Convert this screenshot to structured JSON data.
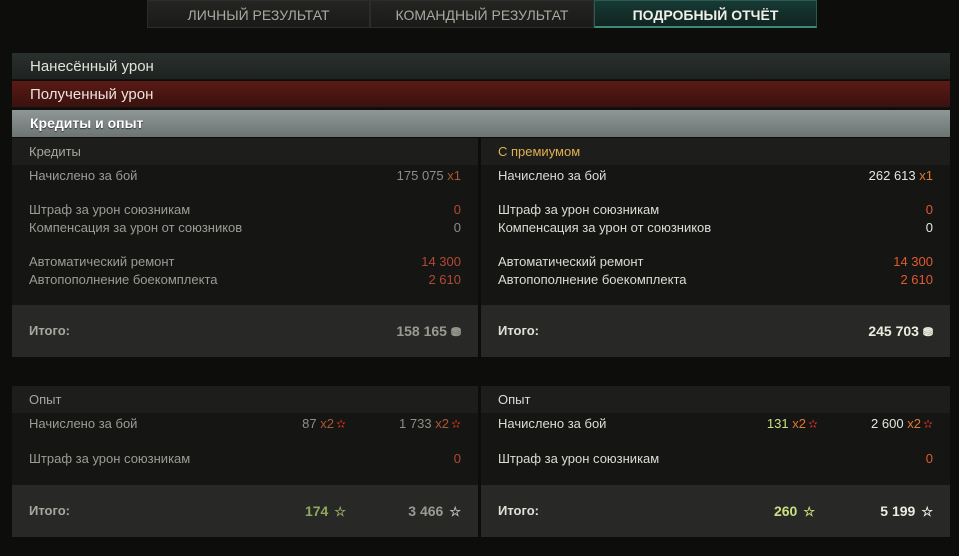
{
  "tabs": [
    "ЛИЧНЫЙ РЕЗУЛЬТАТ",
    "КОМАНДНЫЙ РЕЗУЛЬТАТ",
    "ПОДРОБНЫЙ ОТЧЁТ"
  ],
  "sections": {
    "dealt": "Нанесённый урон",
    "received": "Полученный урон",
    "credits_xp": "Кредиты и опыт"
  },
  "credits": {
    "basic": {
      "title": "Кредиты",
      "earned_label": "Начислено за бой",
      "earned_value": "175 075",
      "earned_mult": "x1",
      "penalty_label": "Штраф за урон союзникам",
      "penalty_value": "0",
      "comp_label": "Компенсация за урон от союзников",
      "comp_value": "0",
      "repair_label": "Автоматический ремонт",
      "repair_value": "14 300",
      "ammo_label": "Автопополнение боекомплекта",
      "ammo_value": "2 610",
      "total_label": "Итого:",
      "total_value": "158 165"
    },
    "premium": {
      "title": "С премиумом",
      "earned_label": "Начислено за бой",
      "earned_value": "262 613",
      "earned_mult": "x1",
      "penalty_label": "Штраф за урон союзникам",
      "penalty_value": "0",
      "comp_label": "Компенсация за урон от союзников",
      "comp_value": "0",
      "repair_label": "Автоматический ремонт",
      "repair_value": "14 300",
      "ammo_label": "Автопополнение боекомплекта",
      "ammo_value": "2 610",
      "total_label": "Итого:",
      "total_value": "245 703"
    }
  },
  "xp": {
    "basic": {
      "title": "Опыт",
      "earned_label": "Начислено за бой",
      "earned_xp": "87",
      "earned_xp_mult": "x2",
      "earned_free": "1 733",
      "earned_free_mult": "x2",
      "penalty_label": "Штраф за урон союзникам",
      "penalty_value": "0",
      "total_label": "Итого:",
      "total_xp": "174",
      "total_free": "3 466"
    },
    "premium": {
      "title": "Опыт",
      "earned_label": "Начислено за бой",
      "earned_xp": "131",
      "earned_xp_mult": "x2",
      "earned_free": "2 600",
      "earned_free_mult": "x2",
      "penalty_label": "Штраф за урон союзникам",
      "penalty_value": "0",
      "total_label": "Итого:",
      "total_xp": "260",
      "total_free": "5 199"
    }
  },
  "icons": {
    "credits": "credits-icon",
    "xp_bonus": "red-star-icon",
    "xp": "star-icon"
  }
}
